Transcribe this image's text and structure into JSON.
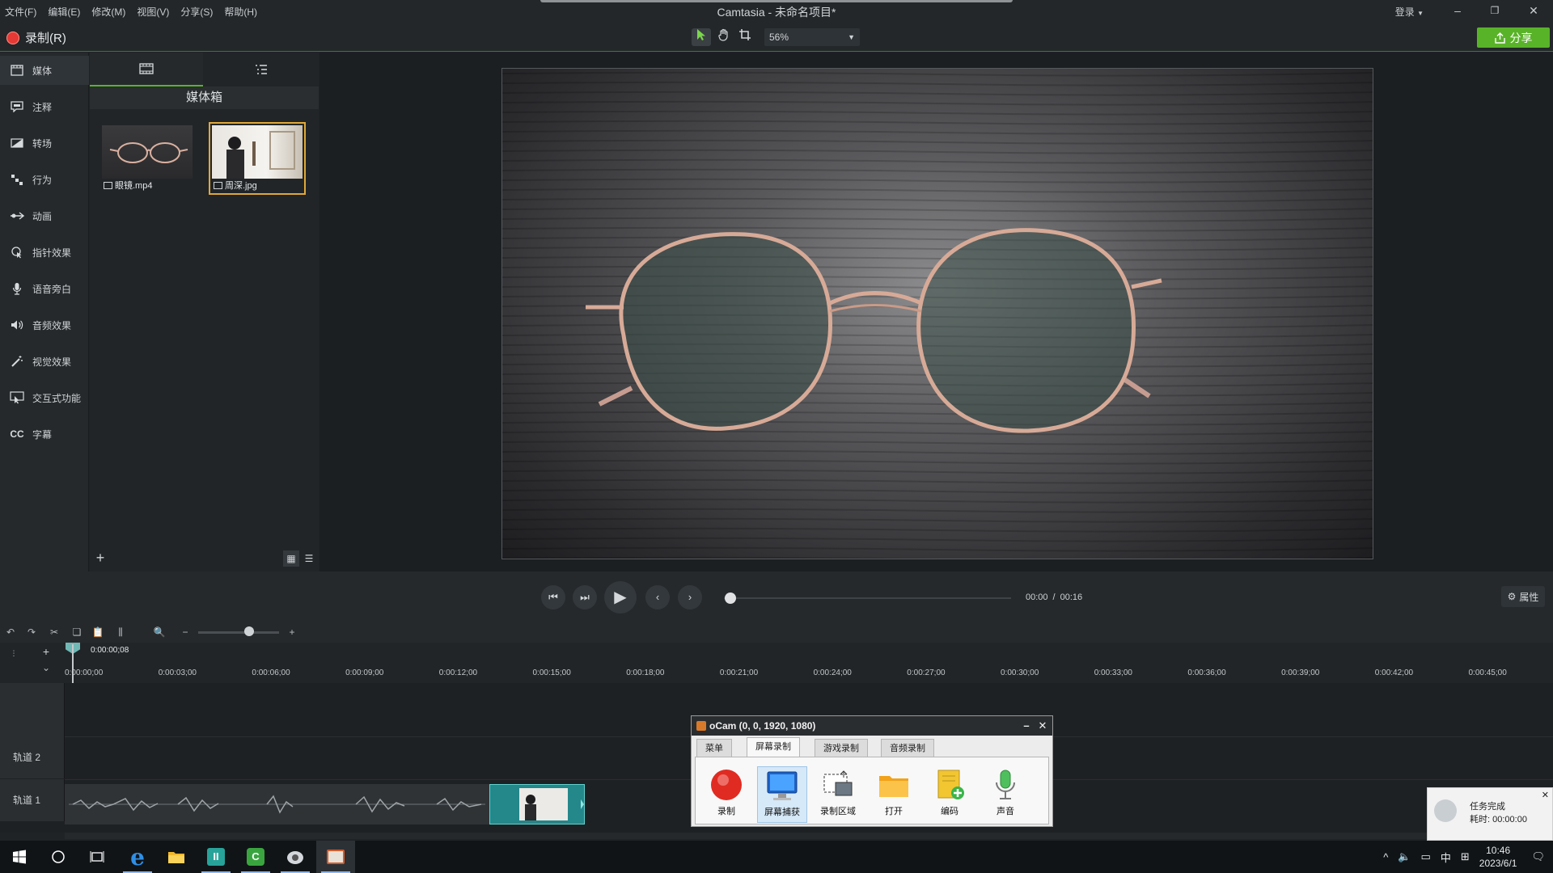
{
  "window": {
    "menus": [
      "文件(F)",
      "编辑(E)",
      "修改(M)",
      "视图(V)",
      "分享(S)",
      "帮助(H)"
    ],
    "title": "Camtasia - 未命名项目*",
    "login": "登录",
    "controls": [
      "–",
      "❐",
      "✕"
    ]
  },
  "toolbar": {
    "record_label": "录制(R)",
    "zoom": "56%",
    "share_label": "分享"
  },
  "sidebar": {
    "items": [
      {
        "label": "媒体",
        "icon": "film-icon"
      },
      {
        "label": "注释",
        "icon": "annotation-icon"
      },
      {
        "label": "转场",
        "icon": "transition-icon"
      },
      {
        "label": "行为",
        "icon": "behavior-icon"
      },
      {
        "label": "动画",
        "icon": "animation-icon"
      },
      {
        "label": "指针效果",
        "icon": "cursor-effect-icon"
      },
      {
        "label": "语音旁白",
        "icon": "microphone-icon"
      },
      {
        "label": "音频效果",
        "icon": "speaker-icon"
      },
      {
        "label": "视觉效果",
        "icon": "magic-wand-icon"
      },
      {
        "label": "交互式功能",
        "icon": "interactive-icon"
      },
      {
        "label": "字幕",
        "icon": "cc-icon"
      }
    ]
  },
  "media": {
    "bin_title": "媒体箱",
    "items": [
      {
        "name": "眼镜.mp4",
        "kind": "video"
      },
      {
        "name": "周深.jpg",
        "kind": "image"
      }
    ],
    "add": "+"
  },
  "playback": {
    "current": "00:00",
    "separator": "/",
    "total": "00:16",
    "progress": 0,
    "properties_label": "属性"
  },
  "timeline": {
    "playhead_time": "0:00:00;08",
    "ticks": [
      "0:00:00;00",
      "0:00:03;00",
      "0:00:06;00",
      "0:00:09;00",
      "0:00:12;00",
      "0:00:15;00",
      "0:00:18;00",
      "0:00:21;00",
      "0:00:24;00",
      "0:00:27;00",
      "0:00:30;00",
      "0:00:33;00",
      "0:00:36;00",
      "0:00:39;00",
      "0:00:42;00",
      "0:00:45;00"
    ],
    "tracks": [
      "轨道 2",
      "轨道 1"
    ]
  },
  "ocam": {
    "title": "oCam (0, 0, 1920, 1080)",
    "tabs": [
      "菜单",
      "屏幕录制",
      "游戏录制",
      "音频录制"
    ],
    "active_tab": "屏幕录制",
    "buttons": [
      "录制",
      "屏幕捕获",
      "录制区域",
      "打开",
      "编码",
      "声音"
    ]
  },
  "notification": {
    "title": "任务完成",
    "detail": "耗时: 00:00:00"
  },
  "taskbar": {
    "time": "10:46",
    "date": "2023/6/1",
    "ime": "中"
  },
  "colors": {
    "accent_green": "#59b329",
    "record_red": "#e53935",
    "selection_orange": "#e0a83a",
    "clip_teal": "#24878a"
  }
}
